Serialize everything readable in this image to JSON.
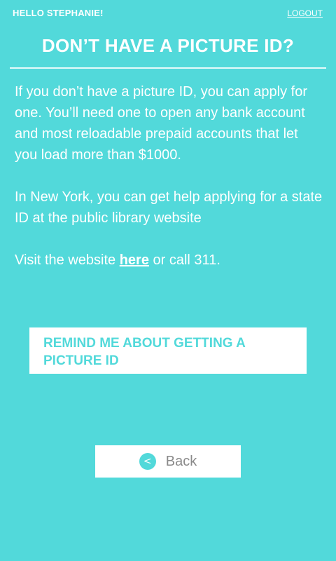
{
  "header": {
    "greeting": "HELLO STEPHANIE!",
    "logout_label": "LOGOUT"
  },
  "page": {
    "title": "DON’T HAVE A PICTURE ID?"
  },
  "content": {
    "paragraph1": "If you don’t have a picture ID, you can apply for one. You’ll need one to open any bank account and most reloadable prepaid accounts that let you load more than $1000.",
    "paragraph2": "In New York, you can get help applying for a state ID at the public library website",
    "visit_prefix": "Visit the website ",
    "visit_link": "here",
    "visit_suffix": " or call 311."
  },
  "actions": {
    "remind_label": "REMIND ME ABOUT GETTING A PICTURE ID",
    "back_label": "Back",
    "back_icon": "chevron-left-icon"
  },
  "colors": {
    "background": "#52d9da",
    "text": "#ffffff",
    "button_bg": "#ffffff",
    "back_label": "#8a8a8a"
  }
}
